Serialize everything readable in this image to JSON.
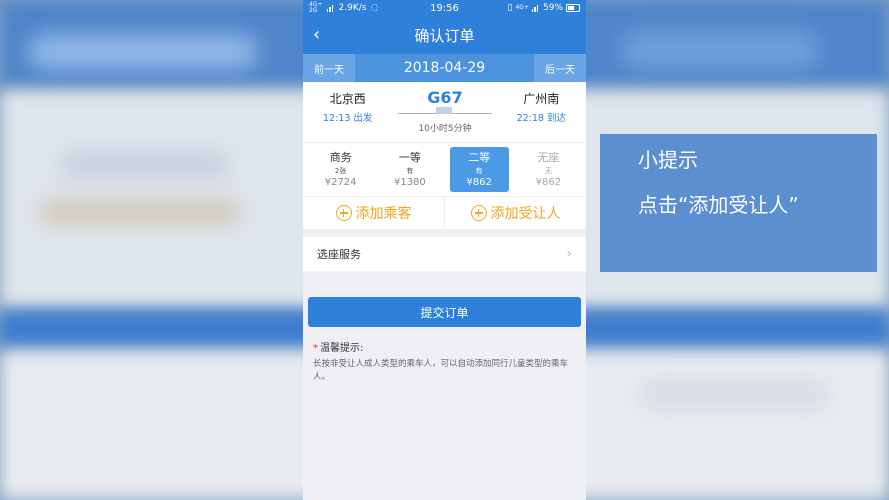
{
  "status_bar": {
    "network_top": "4G+",
    "network_bottom": "2G",
    "speed": "2.9K/s",
    "time": "19:56",
    "network_right": "4G+",
    "battery": "59%"
  },
  "nav": {
    "title": "确认订单",
    "back_icon": "‹"
  },
  "date_bar": {
    "prev": "前一天",
    "date": "2018-04-29",
    "next": "后一天"
  },
  "train": {
    "from_station": "北京西",
    "depart": "12:13 出发",
    "code": "G67",
    "duration": "10小时5分钟",
    "to_station": "广州南",
    "arrive": "22:18 到达"
  },
  "seats": [
    {
      "name": "商务",
      "count": "2张",
      "price": "¥2724"
    },
    {
      "name": "一等",
      "count": "有",
      "price": "¥1380"
    },
    {
      "name": "二等",
      "count": "有",
      "price": "¥862"
    },
    {
      "name": "无座",
      "count": "无",
      "price": "¥862"
    }
  ],
  "actions": {
    "add_passenger": "添加乘客",
    "add_beneficiary": "添加受让人"
  },
  "seat_service": {
    "label": "选座服务"
  },
  "submit": {
    "label": "提交订单"
  },
  "tips": {
    "title": "温馨提示:",
    "body": "长按非受让人成人类型的乘车人，可以自动添加同行儿童类型的乘车人。"
  },
  "hint": {
    "title": "小提示",
    "text": "点击“添加受让人”"
  },
  "colors": {
    "primary": "#2f80d8",
    "accent": "#f2a51a"
  }
}
